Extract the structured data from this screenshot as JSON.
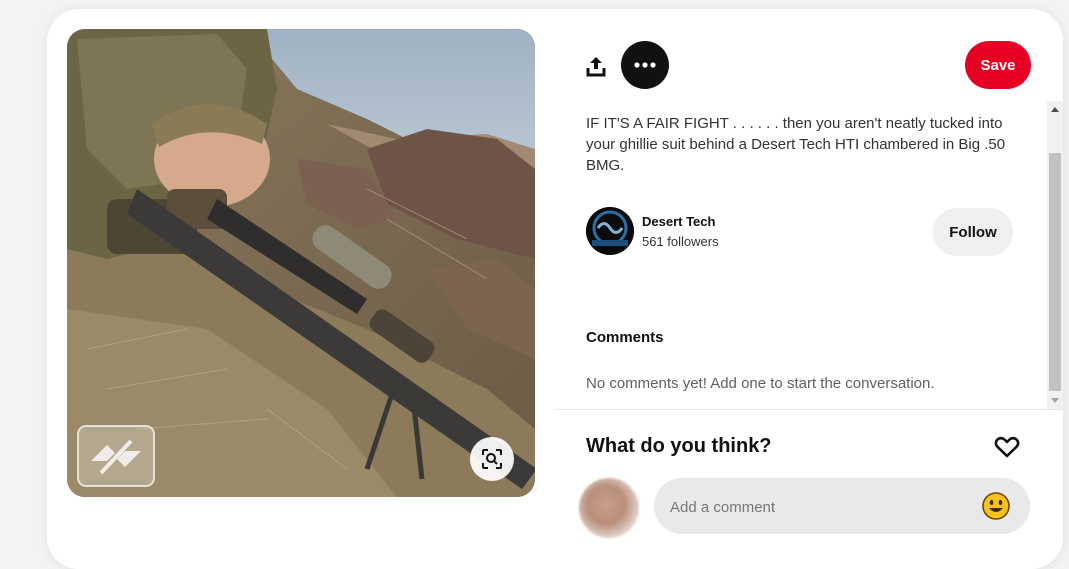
{
  "pin": {
    "description": "IF IT'S A FAIR FIGHT . . . . . . then you aren't neatly tucked into your ghillie suit behind a Desert Tech HTI chambered in Big .50 BMG."
  },
  "actions": {
    "share_icon": "share-upload-icon",
    "more_icon": "ellipsis-icon",
    "save_label": "Save"
  },
  "creator": {
    "name": "Desert Tech",
    "followers": "561 followers",
    "follow_label": "Follow"
  },
  "comments": {
    "heading": "Comments",
    "empty_text": "No comments yet! Add one to start the conversation."
  },
  "footer": {
    "prompt": "What do you think?",
    "heart_icon": "heart-outline-icon",
    "placeholder": "Add a comment",
    "emoji_icon": "smiley-emoji-icon"
  },
  "colors": {
    "save": "#e60023",
    "follow_bg": "#efefef",
    "more_bg": "#111111"
  }
}
